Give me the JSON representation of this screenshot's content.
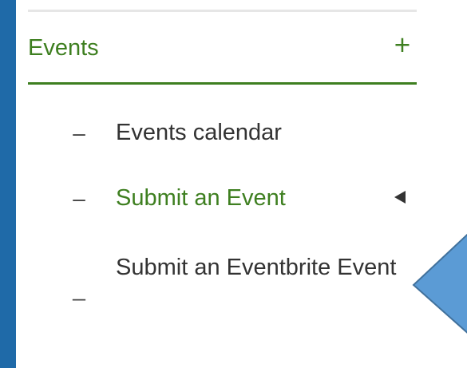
{
  "sidebar": {
    "section": {
      "title": "Events",
      "toggle": "+"
    },
    "items": [
      {
        "label": "Events calendar",
        "bullet": "–",
        "active": false
      },
      {
        "label": "Submit an Event",
        "bullet": "–",
        "active": true
      },
      {
        "label": "Submit an Eventbrite Event",
        "bullet": "_",
        "active": false
      }
    ]
  },
  "colors": {
    "background": "#1f6aa8",
    "accent": "#3e7f20",
    "text": "#333333",
    "callout": "#5b9bd5"
  },
  "icons": {
    "active_marker": "left-triangle-icon",
    "callout": "callout-arrow-shape"
  }
}
